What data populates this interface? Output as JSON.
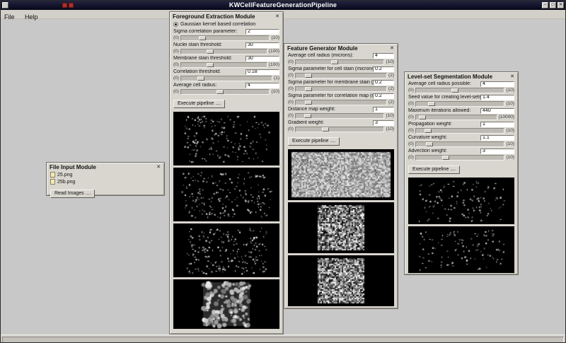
{
  "window": {
    "title": "KWCellFeatureGenerationPipeline",
    "controls": {
      "minimize": "–",
      "maximize": "□",
      "close": "✕"
    }
  },
  "colors": {
    "titlebar": "#14142e",
    "client_bg": "#c8c8c8",
    "panel_bg": "#d8d6cf",
    "accent_red": "#b03028"
  },
  "menu": {
    "file": "File",
    "help": "Help"
  },
  "ui": {
    "close_glyph": "✕"
  },
  "file_input": {
    "title": "File Input Module",
    "files": [
      {
        "name": "25.png"
      },
      {
        "name": "25b.png"
      }
    ],
    "read_button": "Read Images ...."
  },
  "foreground": {
    "title": "Foreground Extraction Module",
    "radio_label": "Gaussian kernel based correlation",
    "execute_button": "Execute pipeline ....",
    "params": [
      {
        "label": "Sigma correlation parameter:",
        "value": "2",
        "min": "(0)",
        "max": "(10)"
      },
      {
        "label": "Nuclei stain threshold:",
        "value": "30",
        "min": "(0)",
        "max": "(100)"
      },
      {
        "label": "Membrane stain threshold:",
        "value": "30",
        "min": "(0)",
        "max": "(100)"
      },
      {
        "label": "Correlation threshold:",
        "value": "0.18",
        "min": "(0)",
        "max": "(1)"
      },
      {
        "label": "Average cell radius:",
        "value": "4",
        "min": "(0)",
        "max": "(10)"
      }
    ],
    "images": [
      {
        "name": "nuclei-channel-preview"
      },
      {
        "name": "membrane-channel-preview"
      },
      {
        "name": "correlation-map-preview"
      },
      {
        "name": "foreground-mask-preview"
      }
    ]
  },
  "feature": {
    "title": "Feature Generator Module",
    "execute_button": "Execute pipeline ....",
    "params": [
      {
        "label": "Average cell radius (microns):",
        "value": "4",
        "min": "(0)",
        "max": "(10)"
      },
      {
        "label": "Sigma parameter for cell stain (microns):",
        "value": "0.2",
        "min": "(0)",
        "max": "(2)"
      },
      {
        "label": "Sigma parameter for membrane stain (microns):",
        "value": "0.2",
        "min": "(0)",
        "max": "(2)"
      },
      {
        "label": "Sigma parameter for correlation map (microns):",
        "value": "0.2",
        "min": "(0)",
        "max": "(2)"
      },
      {
        "label": "Distance map weight:",
        "value": "1",
        "min": "(0)",
        "max": "(10)"
      },
      {
        "label": "Gradient weight:",
        "value": "3",
        "min": "(0)",
        "max": "(10)"
      }
    ],
    "images": [
      {
        "name": "cell-stain-feature-preview"
      },
      {
        "name": "membrane-feature-preview"
      },
      {
        "name": "correlation-feature-preview"
      }
    ]
  },
  "levelset": {
    "title": "Level-set Segmentation Module",
    "execute_button": "Execute pipeline ....",
    "params": [
      {
        "label": "Average cell radius possible:",
        "value": "4",
        "min": "(0)",
        "max": "(10)"
      },
      {
        "label": "Seed value for creating level-sets:",
        "value": "1.4",
        "min": "(0)",
        "max": "(10)"
      },
      {
        "label": "Maximum iterations allowed:",
        "value": "440",
        "min": "(0)",
        "max": "(10000)"
      },
      {
        "label": "Propagation weight:",
        "value": "1",
        "min": "(0)",
        "max": "(10)"
      },
      {
        "label": "Curvature weight:",
        "value": "1.1",
        "min": "(0)",
        "max": "(10)"
      },
      {
        "label": "Advection weight:",
        "value": "3",
        "min": "(0)",
        "max": "(10)"
      }
    ],
    "images": [
      {
        "name": "segmentation-seeds-preview"
      },
      {
        "name": "segmentation-result-preview"
      }
    ]
  }
}
